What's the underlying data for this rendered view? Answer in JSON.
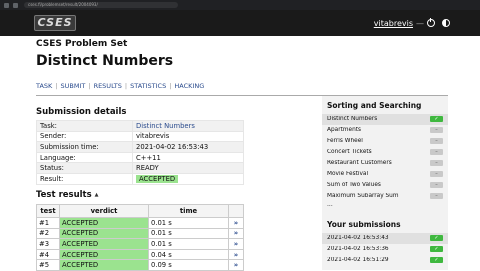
{
  "browser": {
    "url": "cses.fi/problemset/result/2004093/"
  },
  "header": {
    "logo": "CSES",
    "user": "vitabrevis",
    "separator": "—"
  },
  "problemset_title": "CSES Problem Set",
  "page_title": "Distinct Numbers",
  "nav": {
    "tabs": [
      "TASK",
      "SUBMIT",
      "RESULTS",
      "STATISTICS",
      "HACKING"
    ]
  },
  "submission": {
    "heading": "Submission details",
    "rows": [
      {
        "key": "Task:",
        "value": "Distinct Numbers"
      },
      {
        "key": "Sender:",
        "value": "vitabrevis"
      },
      {
        "key": "Submission time:",
        "value": "2021-04-02 16:53:43"
      },
      {
        "key": "Language:",
        "value": "C++11"
      },
      {
        "key": "Status:",
        "value": "READY"
      },
      {
        "key": "Result:",
        "value": "ACCEPTED"
      }
    ]
  },
  "tests": {
    "heading": "Test",
    "heading_link": "results",
    "caret": "▲",
    "columns": [
      "test",
      "verdict",
      "time"
    ],
    "rows": [
      {
        "test": "#1",
        "verdict": "ACCEPTED",
        "time": "0.01 s"
      },
      {
        "test": "#2",
        "verdict": "ACCEPTED",
        "time": "0.01 s"
      },
      {
        "test": "#3",
        "verdict": "ACCEPTED",
        "time": "0.01 s"
      },
      {
        "test": "#4",
        "verdict": "ACCEPTED",
        "time": "0.04 s"
      },
      {
        "test": "#5",
        "verdict": "ACCEPTED",
        "time": "0.09 s"
      }
    ],
    "arrow": "»"
  },
  "sidebar": {
    "section_title": "Sorting and Searching",
    "problems": [
      {
        "name": "Distinct Numbers",
        "status": "solved",
        "mark": "✓"
      },
      {
        "name": "Apartments",
        "status": "unsolved",
        "mark": "–"
      },
      {
        "name": "Ferris Wheel",
        "status": "unsolved",
        "mark": "–"
      },
      {
        "name": "Concert Tickets",
        "status": "unsolved",
        "mark": "–"
      },
      {
        "name": "Restaurant Customers",
        "status": "unsolved",
        "mark": "–"
      },
      {
        "name": "Movie Festival",
        "status": "unsolved",
        "mark": "–"
      },
      {
        "name": "Sum of Two Values",
        "status": "unsolved",
        "mark": "–"
      },
      {
        "name": "Maximum Subarray Sum",
        "status": "unsolved",
        "mark": "–"
      }
    ],
    "more": "...",
    "your_submissions_title": "Your submissions",
    "submissions": [
      {
        "time": "2021-04-02 16:53:43",
        "mark": "✓"
      },
      {
        "time": "2021-04-02 16:53:36",
        "mark": "✓"
      },
      {
        "time": "2021-04-02 16:51:29",
        "mark": "✓"
      }
    ]
  },
  "colors": {
    "accepted": "#9be38f",
    "link": "#2a4b8d",
    "header_bg": "#1a1a1a",
    "solved": "#3fb83f"
  }
}
